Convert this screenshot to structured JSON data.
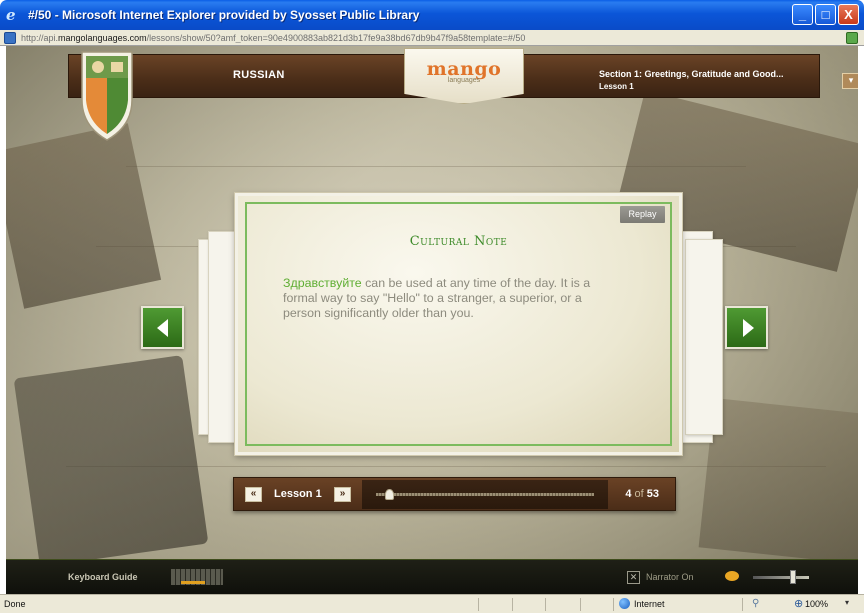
{
  "window": {
    "title": "#/50 - Microsoft Internet Explorer provided by Syosset Public Library",
    "minimize": "_",
    "maximize": "□",
    "close": "X"
  },
  "address": {
    "prefix": "http://api.",
    "domain": "mangolanguages.com",
    "suffix": "/lessons/show/50?amf_token=90e4900883ab821d3b17fe9a38bd67db9b47f9a58template=#/50"
  },
  "header": {
    "language": "RUSSIAN",
    "logo_word": "mango",
    "logo_sub": "languages",
    "section_title": "Section 1: Greetings, Gratitude and Good...",
    "lesson_title": "Lesson 1",
    "dropdown_glyph": "▾"
  },
  "card": {
    "replay_label": "Replay",
    "heading": "Cultural Note",
    "russian_word": "Здравствуйте",
    "body_text": " can be used at any time of the day. It is a formal way to say \"Hello\" to a stranger, a superior, or a person significantly older than you."
  },
  "lesson_bar": {
    "prev_glyph": "«",
    "next_glyph": "»",
    "lesson_label": "Lesson 1",
    "current_slide": "4",
    "of_text": " of ",
    "total_slides": "53",
    "progress_fraction": 0.06
  },
  "footer": {
    "keyboard_guide": "Keyboard Guide",
    "narrator_label": "Narrator On",
    "narrator_icon_glyph": "✕",
    "volume_level": 0.72
  },
  "statusbar": {
    "status": "Done",
    "zone": "Internet",
    "zoom": "100%",
    "protected_glyph": "⚲",
    "zoom_glyph": "⊕",
    "zoom_arrow": "▾"
  },
  "colors": {
    "accent_green": "#5fae33",
    "heading_green": "#3c8a28",
    "header_brown": "#4a2d18",
    "logo_orange": "#e0742a"
  }
}
